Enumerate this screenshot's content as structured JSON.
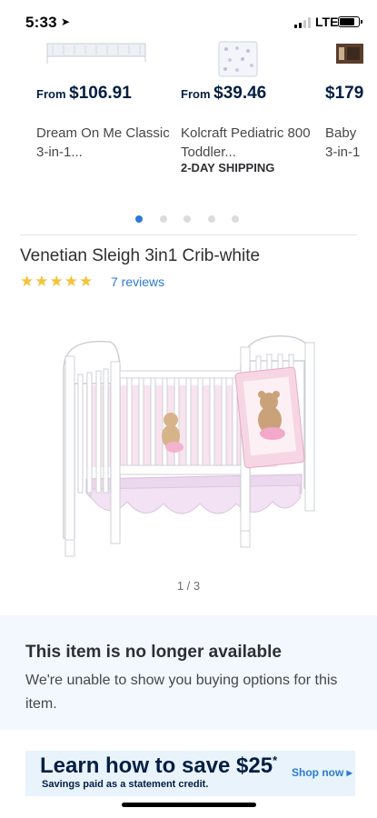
{
  "status_bar": {
    "time": "5:33",
    "location_icon": "location-arrow-icon",
    "network": "LTE",
    "signal_bars": 2,
    "signal_total": 4,
    "battery_level": 0.85
  },
  "carousel": {
    "items": [
      {
        "price_prefix": "From ",
        "price": "$106.91",
        "title": "Dream On Me Classic 3-in-1...",
        "shipping": ""
      },
      {
        "price_prefix": "From ",
        "price": "$39.46",
        "title": "Kolcraft Pediatric 800 Toddler...",
        "shipping": "2-DAY SHIPPING"
      },
      {
        "price_prefix": "",
        "price": "$179",
        "title": "Baby 3-in-1",
        "shipping": ""
      }
    ],
    "dots_total": 5,
    "active_dot": 0
  },
  "product": {
    "title": "Venetian Sleigh 3in1 Crib-white",
    "rating_stars": "★★★★★",
    "rating": 5,
    "reviews_label": "7 reviews",
    "image_counter": "1 / 3"
  },
  "unavailable": {
    "title": "This item is no longer available",
    "message": "We're unable to show you buying options for this item."
  },
  "promo": {
    "title": "Learn how to save $25",
    "title_mark": "*",
    "subtitle": "Savings paid as a statement credit.",
    "cta": "Shop now ▸"
  },
  "colors": {
    "brand_navy": "#041e42",
    "link_blue": "#2b7bd6",
    "star_gold": "#f5c23c",
    "info_bg": "#f2f8fd"
  }
}
